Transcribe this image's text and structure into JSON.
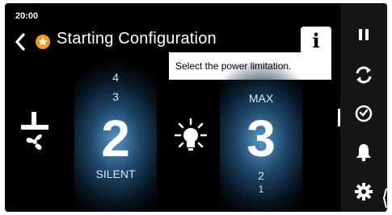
{
  "status": {
    "time": "20:00"
  },
  "header": {
    "title": "Starting Configuration"
  },
  "tooltip": {
    "text": "Select the power limitation."
  },
  "info_button": {
    "glyph": "i"
  },
  "fan_selector": {
    "above_2": "4",
    "above_1": "3",
    "current": "2",
    "below_label": "SILENT"
  },
  "power_selector": {
    "above_label": "MAX",
    "current": "3",
    "below_1": "2",
    "below_2": "1"
  },
  "sidebar": {
    "items": [
      "pause-icon",
      "refresh-icon",
      "timer-icon",
      "bell-icon",
      "settings-icon"
    ]
  },
  "colors": {
    "accent_orange": "#f39a1e",
    "wheel_blue": "#4f8fc0"
  }
}
